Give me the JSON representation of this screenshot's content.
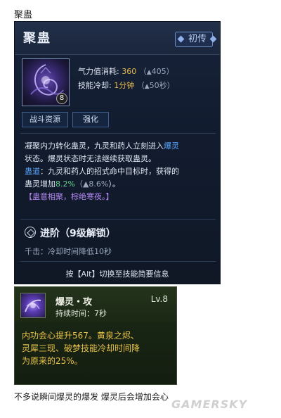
{
  "page_heading": "聚蛊",
  "skill": {
    "title": "聚蛊",
    "rank_badge": "初传",
    "icon": "swirling-purple-gu-icon",
    "icon_level": "8",
    "stats": {
      "qi_cost_label": "气力值消耗:",
      "qi_cost_value": "360",
      "qi_cost_next": "405",
      "cooldown_label": "技能冷却:",
      "cooldown_value": "1分钟",
      "cooldown_next": "50秒"
    },
    "tags": [
      "战斗资源",
      "强化"
    ],
    "description": {
      "line1_a": "凝聚内力转化蛊灵，九灵和药人立刻进入",
      "line1_b": "爆灵",
      "line2": "状态。爆灵状态时无法继续获取蛊灵。",
      "line3_a": "蛊道",
      "line3_b": "：九灵和药人的招式命中目标时，获得的",
      "line4_a": "蛊灵增加",
      "line4_b": "8.2%",
      "line4_c": "8.6%",
      "line4_d": "）。",
      "line5": "【蛊意相聚，棕绝寒夜。】"
    },
    "advance": {
      "title": "进阶（9级解锁）",
      "sub": "千击：冷却时间降低10秒"
    },
    "switch_hint": "按【Alt】切换至技能简要信息"
  },
  "buff": {
    "icon": "purple-burst-buff-icon",
    "name": "爆灵・攻",
    "level": "Lv.8",
    "duration": "持续时间：7秒",
    "desc_lines": [
      "内功会心提升567。黄泉之烬、",
      "灵犀三现、破梦技能冷却时间降",
      "为原来的25%。"
    ]
  },
  "caption": "不多说瞬间爆灵的爆发 爆灵后会增加会心",
  "watermark": "GAMERSKY"
}
